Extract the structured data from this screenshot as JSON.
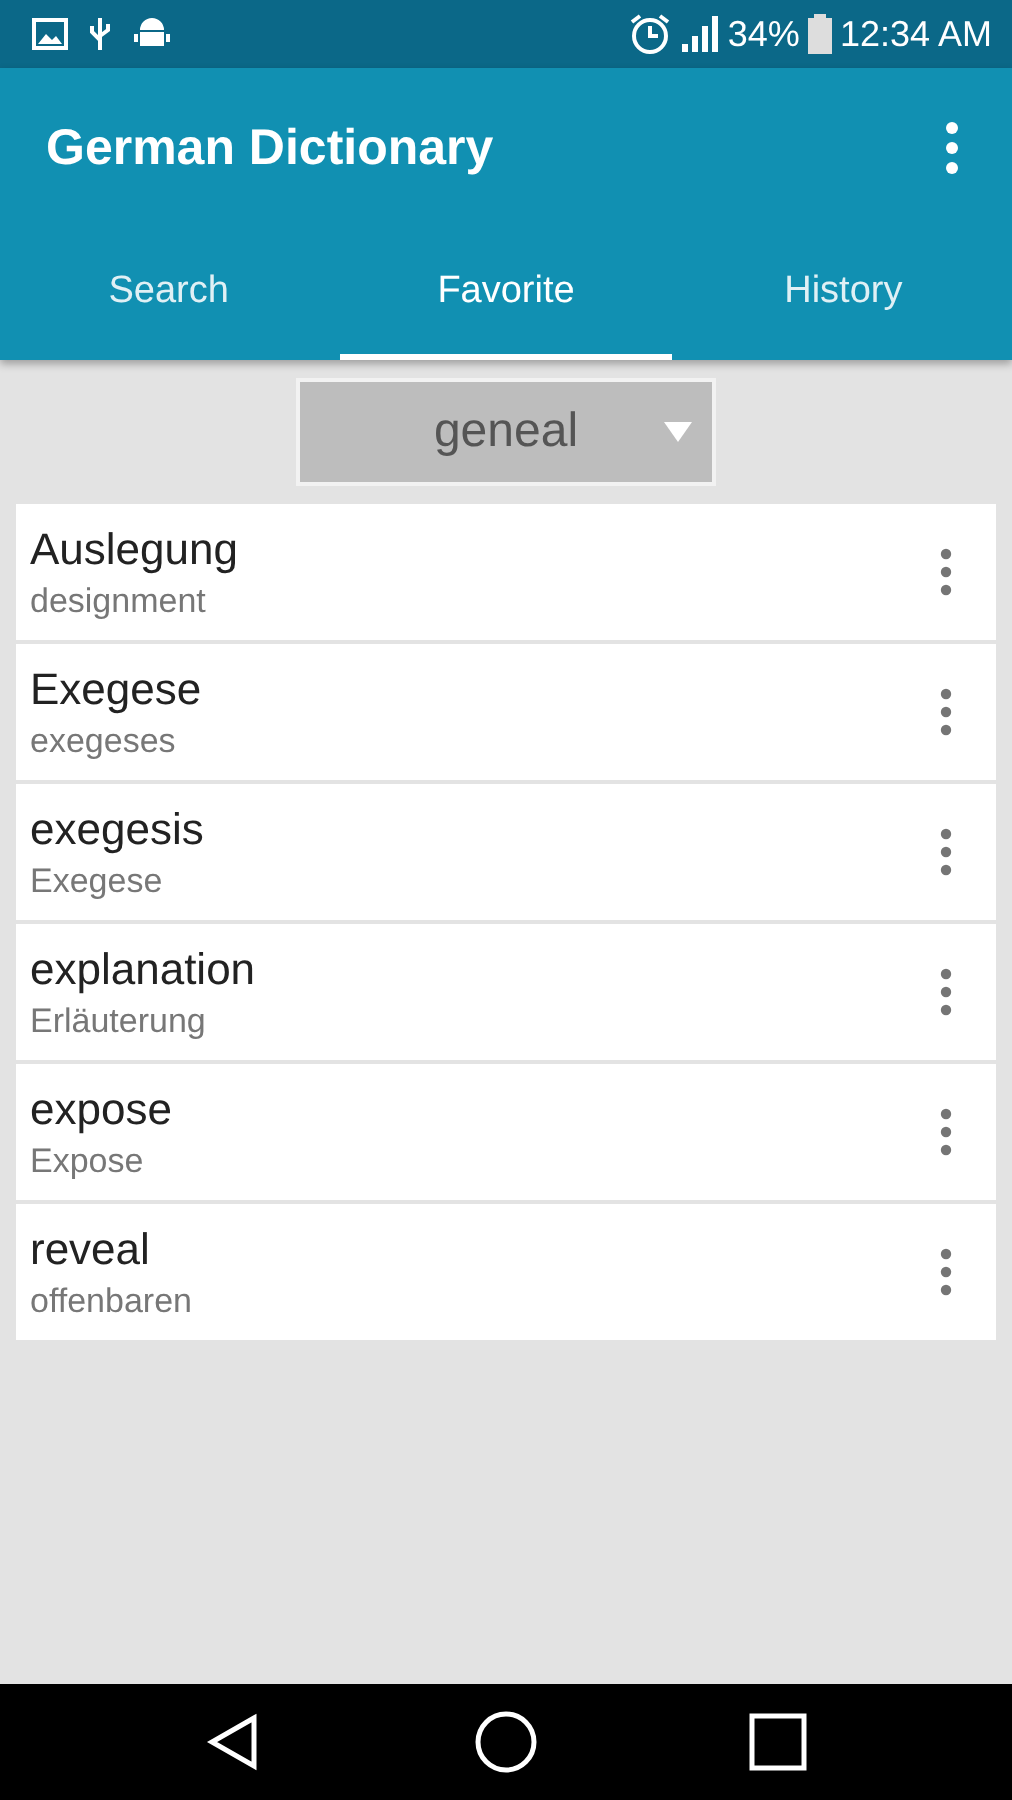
{
  "status_bar": {
    "battery": "34%",
    "time": "12:34 AM"
  },
  "app_bar": {
    "title": "German Dictionary"
  },
  "tabs": [
    {
      "label": "Search",
      "selected": false
    },
    {
      "label": "Favorite",
      "selected": true
    },
    {
      "label": "History",
      "selected": false
    }
  ],
  "dropdown": {
    "value": "geneal"
  },
  "entries": [
    {
      "word": "Auslegung",
      "translation": "designment"
    },
    {
      "word": "Exegese",
      "translation": "exegeses"
    },
    {
      "word": "exegesis",
      "translation": "Exegese"
    },
    {
      "word": "explanation",
      "translation": "Erläuterung"
    },
    {
      "word": "expose",
      "translation": "Expose"
    },
    {
      "word": "reveal",
      "translation": "offenbaren"
    }
  ]
}
